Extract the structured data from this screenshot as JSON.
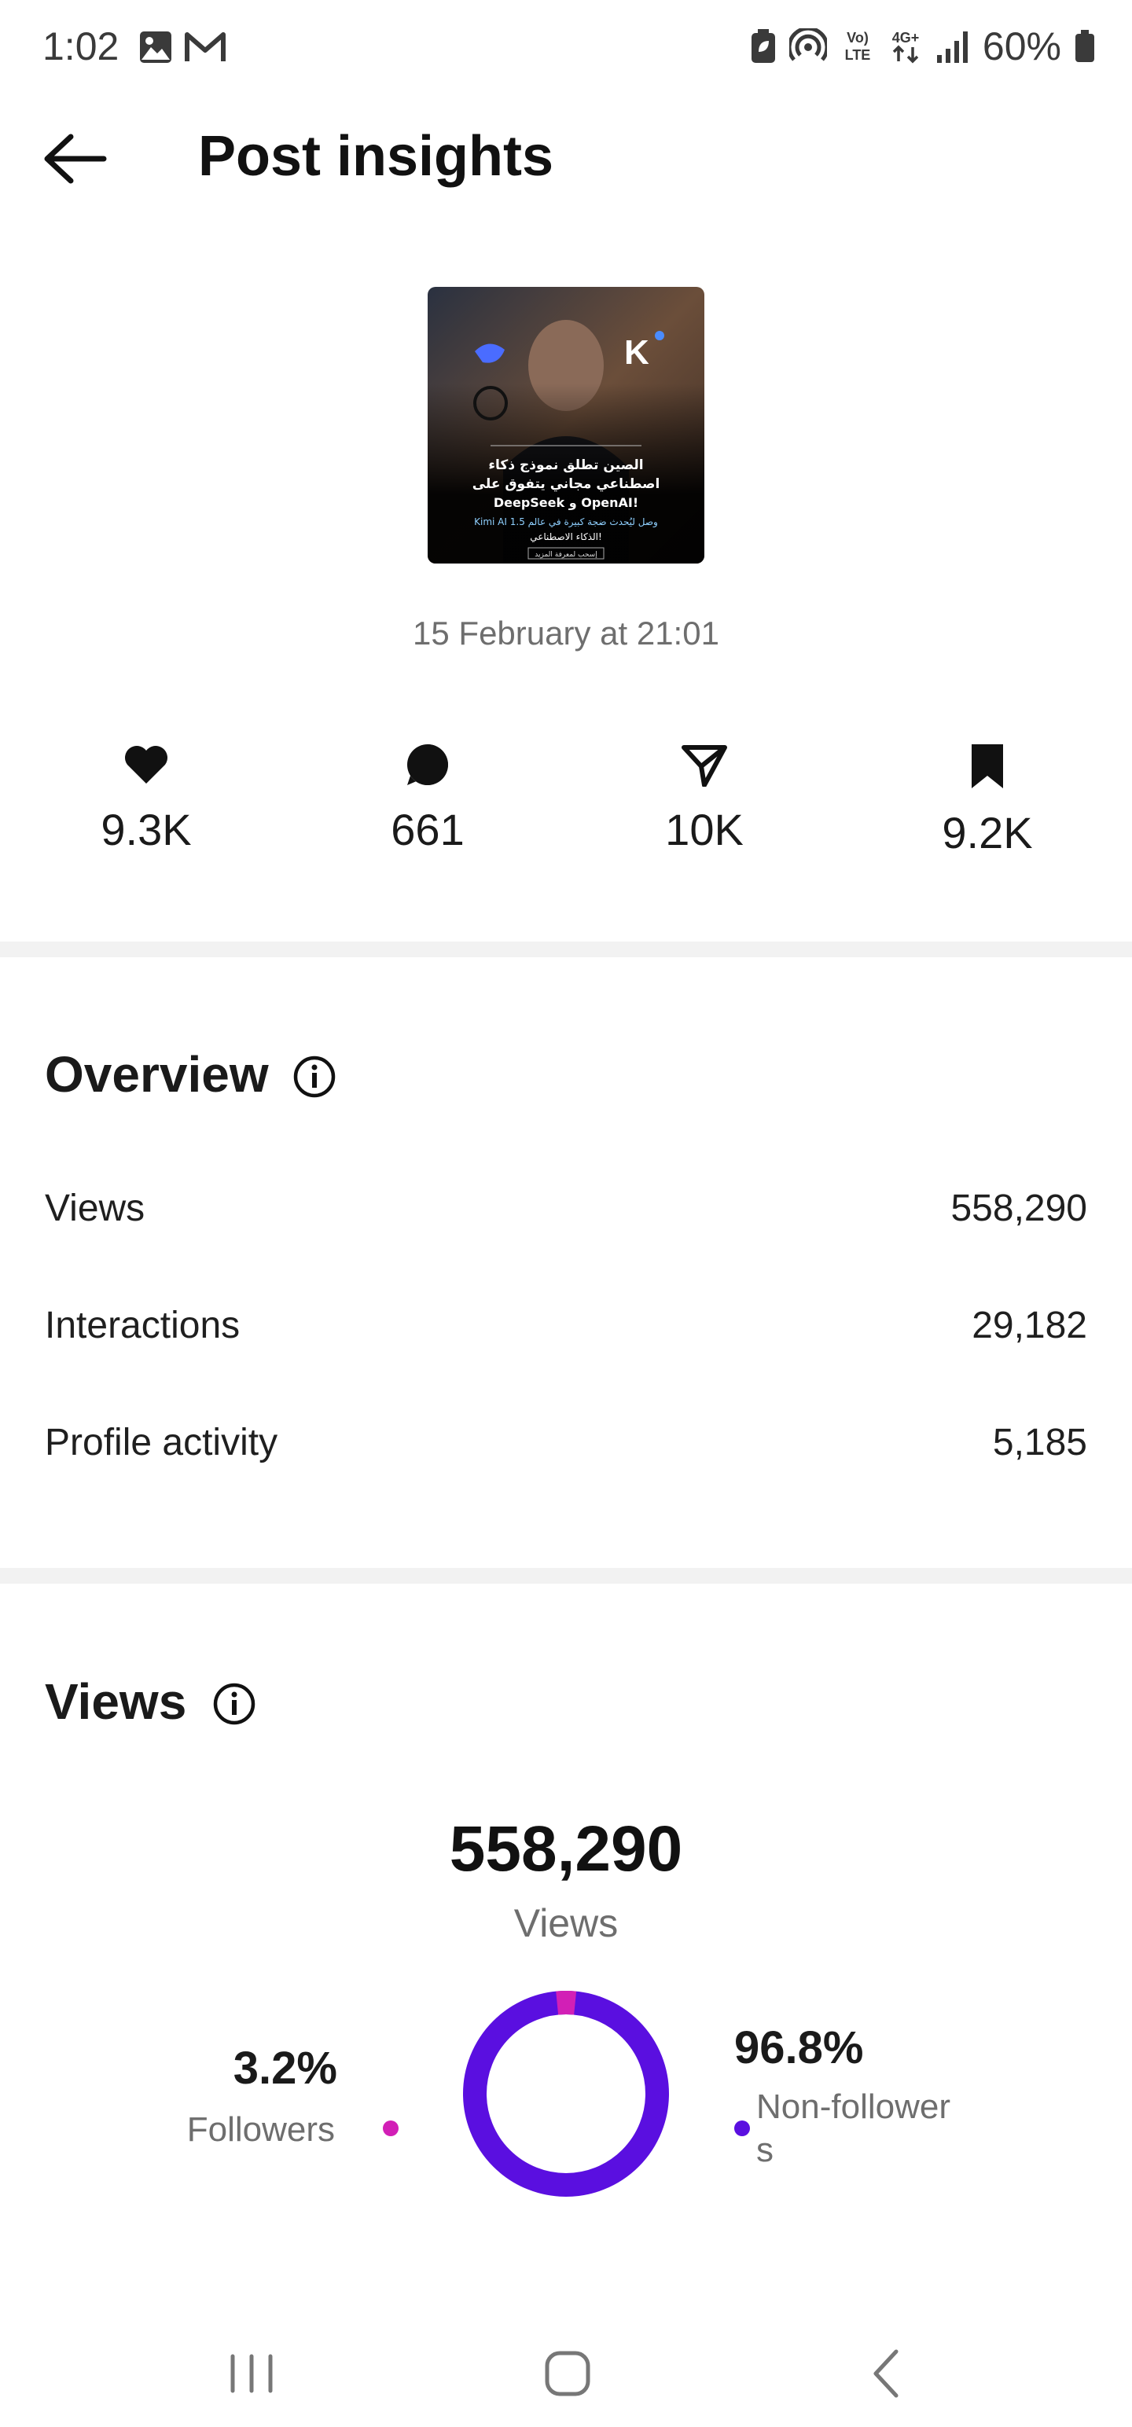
{
  "status_bar": {
    "time": "1:02",
    "battery": "60%",
    "icons": [
      "image-icon",
      "gmail-icon",
      "battery-saver-icon",
      "hotspot-icon",
      "volte-icon",
      "4g-icon",
      "signal-icon",
      "battery-icon"
    ],
    "volte_top": "Vo)",
    "volte_bottom": "LTE",
    "net_label": "4G+"
  },
  "header": {
    "title": "Post insights",
    "back_icon": "arrow-left-icon"
  },
  "post": {
    "date": "15 February at 21:01",
    "thumbnail_text": {
      "line1": "الصين تطلق نموذج ذكاء",
      "line2": "اصطناعي مجاني يتفوق على",
      "line3": "DeepSeek و OpenAI!",
      "line4": "Kimi AI 1.5 وصل ليُحدث ضجة كبيرة في عالم",
      "line5": "الذكاء الاصطناعي!",
      "line6": "إسحب لمعرفة المزيد"
    }
  },
  "stats": [
    {
      "icon": "heart-icon",
      "value": "9.3K"
    },
    {
      "icon": "comment-icon",
      "value": "661"
    },
    {
      "icon": "send-icon",
      "value": "10K"
    },
    {
      "icon": "bookmark-icon",
      "value": "9.2K"
    }
  ],
  "overview": {
    "title": "Overview",
    "rows": [
      {
        "label": "Views",
        "value": "558,290"
      },
      {
        "label": "Interactions",
        "value": "29,182"
      },
      {
        "label": "Profile activity",
        "value": "5,185"
      }
    ]
  },
  "views": {
    "title": "Views",
    "total": "558,290",
    "total_label": "Views",
    "followers_pct": "3.2%",
    "followers_label": "Followers",
    "nonfollowers_pct": "96.8%",
    "nonfollowers_label_line1": "Non-follower",
    "nonfollowers_label_line2": "s",
    "followers_share": 0.032,
    "nonfollowers_share": 0.968,
    "followers_color": "#d21fb6",
    "nonfollowers_color": "#5a0fe0"
  },
  "navbar": {
    "icons": [
      "recent-apps-icon",
      "home-icon",
      "back-icon"
    ]
  }
}
